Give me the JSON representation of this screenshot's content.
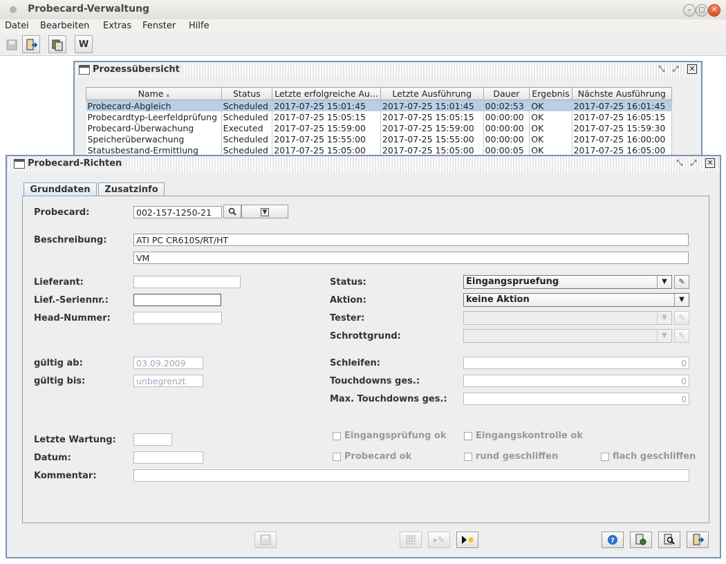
{
  "window": {
    "title": "Probecard-Verwaltung"
  },
  "menu": [
    "Datei",
    "Bearbeiten",
    "Extras",
    "Fenster",
    "Hilfe"
  ],
  "toolbar": {
    "w_label": "W"
  },
  "process_frame": {
    "title": "Prozessübersicht",
    "columns": [
      "Name",
      "Status",
      "Letzte erfolgreiche Au...",
      "Letzte Ausführung",
      "Dauer",
      "Ergebnis",
      "Nächste Ausführung"
    ],
    "rows": [
      [
        "Probecard-Abgleich",
        "Scheduled",
        "2017-07-25 15:01:45",
        "2017-07-25 15:01:45",
        "00:02:53",
        "OK",
        "2017-07-25 16:01:45"
      ],
      [
        "Probecardtyp-Leerfeldprüfung",
        "Scheduled",
        "2017-07-25 15:05:15",
        "2017-07-25 15:05:15",
        "00:00:00",
        "OK",
        "2017-07-25 16:05:15"
      ],
      [
        "Probecard-Überwachung",
        "Executed",
        "2017-07-25 15:59:00",
        "2017-07-25 15:59:00",
        "00:00:00",
        "OK",
        "2017-07-25 15:59:30"
      ],
      [
        "Speicherüberwachung",
        "Scheduled",
        "2017-07-25 15:55:00",
        "2017-07-25 15:55:00",
        "00:00:00",
        "OK",
        "2017-07-25 16:00:00"
      ],
      [
        "Statusbestand-Ermittlung",
        "Scheduled",
        "2017-07-25 15:05:00",
        "2017-07-25 15:05:00",
        "00:00:05",
        "OK",
        "2017-07-25 16:05:00"
      ]
    ],
    "selected_row": 0
  },
  "edit_frame": {
    "title": "Probecard-Richten",
    "tabs": [
      "Grunddaten",
      "Zusatzinfo"
    ],
    "labels": {
      "probecard": "Probecard:",
      "beschreibung": "Beschreibung:",
      "lieferant": "Lieferant:",
      "lief_seriennr": "Lief.-Seriennr.:",
      "head_nummer": "Head-Nummer:",
      "gueltig_ab": "gültig ab:",
      "gueltig_bis": "gültig bis:",
      "letzte_wartung": "Letzte Wartung:",
      "datum": "Datum:",
      "kommentar": "Kommentar:",
      "status": "Status:",
      "aktion": "Aktion:",
      "tester": "Tester:",
      "schrottgrund": "Schrottgrund:",
      "schleifen": "Schleifen:",
      "touchdowns": "Touchdowns ges.:",
      "max_touchdowns": "Max. Touchdowns ges.:"
    },
    "values": {
      "probecard": "002-157-1250-21",
      "beschreibung1": "ATI PC CR610S/RT/HT",
      "beschreibung2": "VM",
      "lieferant": "",
      "lief_seriennr": "",
      "head_nummer": "",
      "gueltig_ab": "03.09.2009",
      "gueltig_bis": "unbegrenzt",
      "letzte_wartung": "",
      "datum": "",
      "kommentar": "",
      "status": "Eingangspruefung",
      "aktion": "keine Aktion",
      "tester": "",
      "schrottgrund": "",
      "schleifen": "0",
      "touchdowns": "0",
      "max_touchdowns": "0"
    },
    "checkboxes": {
      "eingangspruefung_ok": "Eingangsprüfung ok",
      "eingangskontrolle_ok": "Eingangskontrolle ok",
      "probecard_ok": "Probecard ok",
      "rund_geschliffen": "rund geschliffen",
      "flach_geschliffen": "flach geschliffen"
    }
  }
}
